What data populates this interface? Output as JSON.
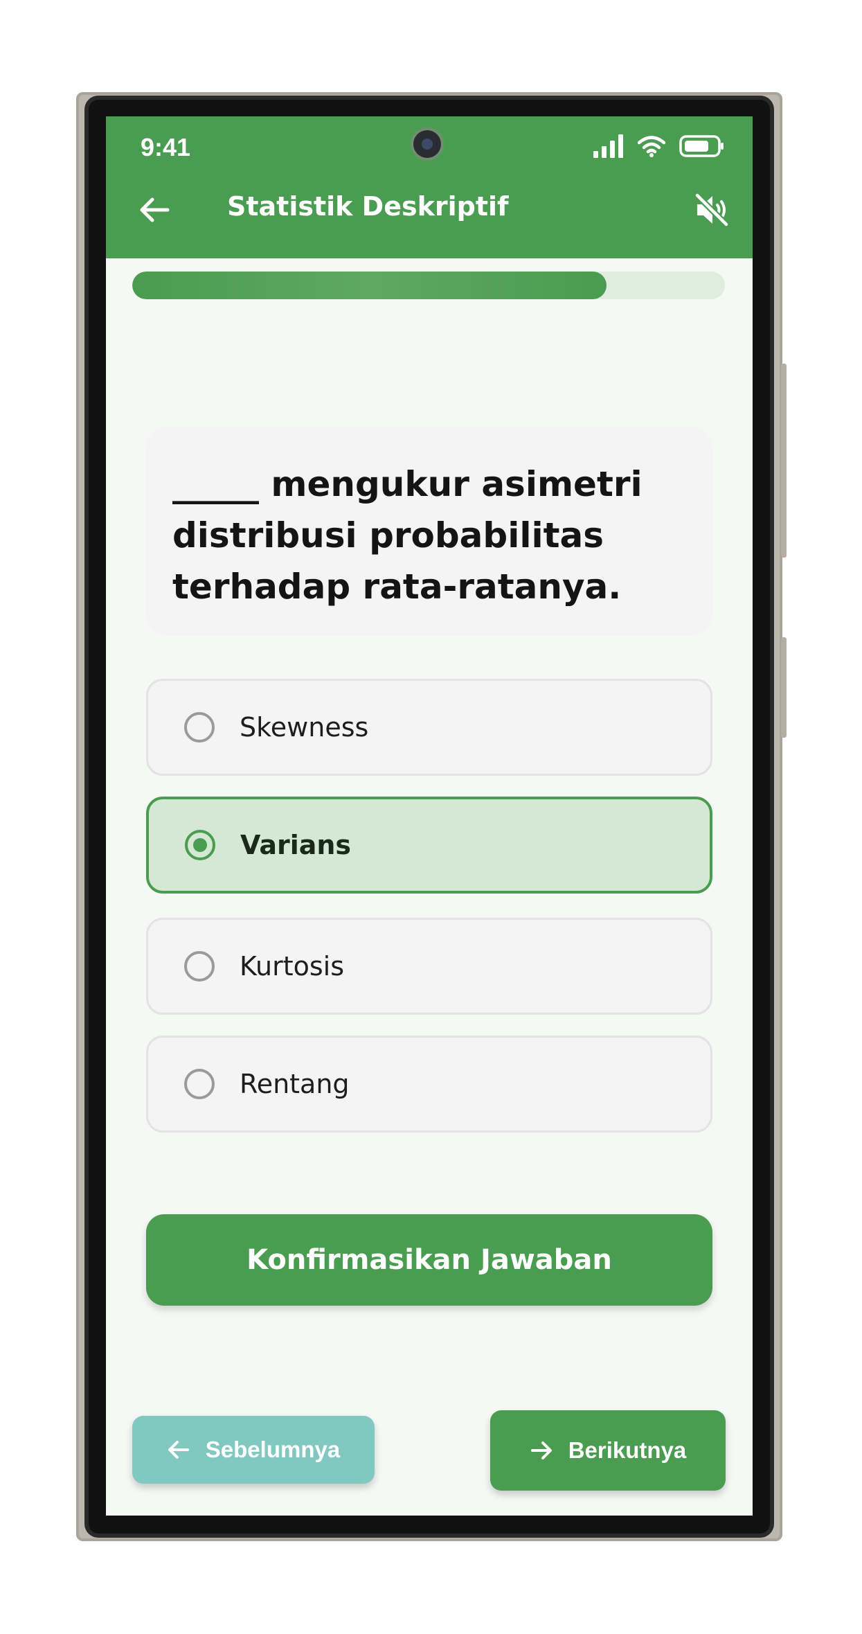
{
  "status_bar": {
    "time": "9:41"
  },
  "header": {
    "title": "Statistik Deskriptif",
    "back_icon": "arrow-left-icon",
    "sound_icon": "volume-mute-icon"
  },
  "progress": {
    "fraction": 0.8
  },
  "question": {
    "text": "_____ mengukur asimetri distribusi probabilitas terhadap rata-ratanya."
  },
  "options": [
    {
      "label": "Skewness",
      "selected": false
    },
    {
      "label": "Varians",
      "selected": true
    },
    {
      "label": "Kurtosis",
      "selected": false
    },
    {
      "label": "Rentang",
      "selected": false
    }
  ],
  "actions": {
    "confirm_label": "Konfirmasikan Jawaban",
    "prev_label": "Sebelumnya",
    "next_label": "Berikutnya"
  },
  "colors": {
    "primary": "#4a9c50",
    "selected_bg": "#d4e8d4",
    "prev_button": "#80c8c0",
    "background": "#f5f8f5"
  }
}
